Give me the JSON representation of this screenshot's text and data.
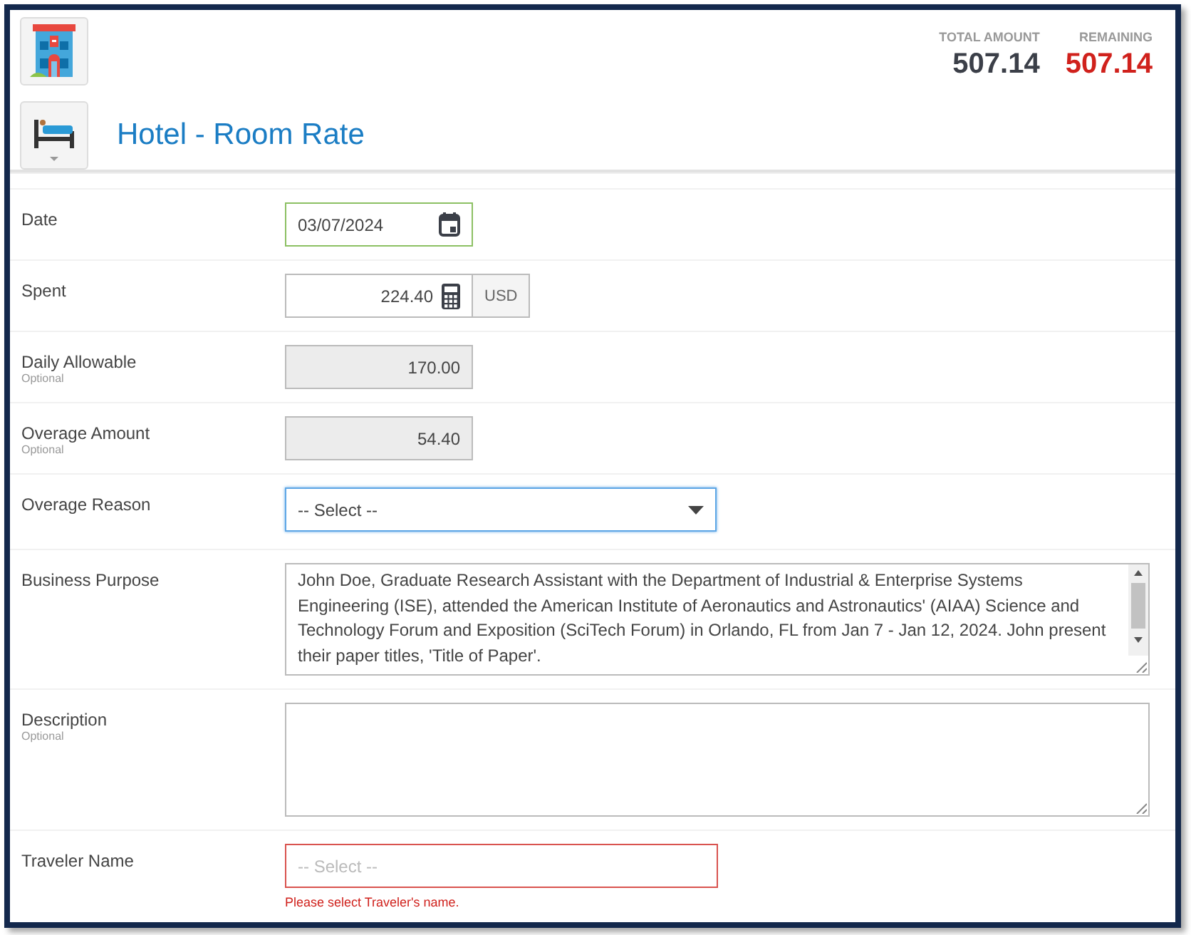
{
  "header": {
    "title": "Hotel - Room Rate",
    "totals": [
      {
        "label": "TOTAL AMOUNT",
        "value": "507.14",
        "kind": "total"
      },
      {
        "label": "REMAINING",
        "value": "507.14",
        "kind": "remaining"
      }
    ]
  },
  "fields": [
    {
      "label": "Date",
      "kind": "date",
      "value": "03/07/2024"
    },
    {
      "label": "Spent",
      "kind": "money",
      "value": "224.40",
      "currency": "USD"
    },
    {
      "label": "Daily Allowable",
      "optional": "Optional",
      "kind": "readonly",
      "value": "170.00"
    },
    {
      "label": "Overage Amount",
      "optional": "Optional",
      "kind": "readonly",
      "value": "54.40"
    },
    {
      "label": "Overage Reason",
      "kind": "select",
      "value": "-- Select --"
    },
    {
      "label": "Business Purpose",
      "kind": "textarea",
      "value": "John Doe, Graduate Research Assistant with the Department of Industrial & Enterprise Systems Engineering (ISE), attended the American Institute of Aeronautics and Astronautics' (AIAA) Science and Technology Forum and Exposition (SciTech Forum) in Orlando, FL from Jan 7 - Jan 12, 2024. John present their paper titles, 'Title of Paper'."
    },
    {
      "label": "Description",
      "optional": "Optional",
      "kind": "textarea"
    },
    {
      "label": "Traveler Name",
      "kind": "select-error",
      "placeholder": "-- Select --",
      "error": "Please select Traveler's name."
    }
  ]
}
